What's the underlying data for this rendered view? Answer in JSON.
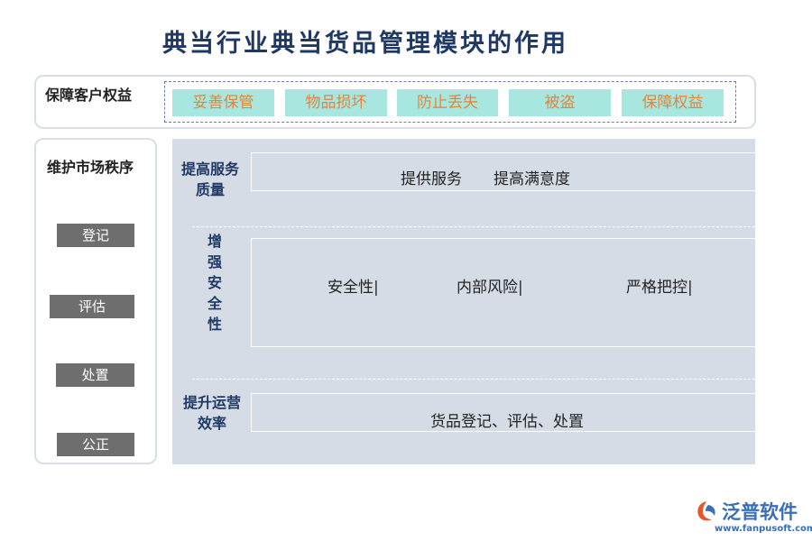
{
  "title": "典当行业典当货品管理模块的作用",
  "guarantee": {
    "label": "保障客户权益",
    "items": [
      "妥善保管",
      "物品损坏",
      "防止丢失",
      "被盗",
      "保障权益"
    ]
  },
  "market_order": {
    "label": "维护市场秩序",
    "steps": [
      "登记",
      "评估",
      "处置",
      "公正"
    ]
  },
  "sections": {
    "service": {
      "label_line1": "提高服务",
      "label_line2": "质量",
      "text1": "提供服务",
      "text2": "提高满意度"
    },
    "safety": {
      "label_chars": [
        "增",
        "强",
        "安",
        "全",
        "性"
      ],
      "items": [
        "安全性|",
        "内部风险|",
        "严格把控|"
      ]
    },
    "efficiency": {
      "label_line1": "提升运营",
      "label_line2": "效率",
      "text": "货品登记、评估、处置"
    }
  },
  "logo": {
    "name": "泛普软件",
    "url": "www.fanpusoft.com"
  },
  "colors": {
    "title": "#1f3864",
    "chip_bg": "#a8e6e0",
    "chip_text": "#e0863a",
    "panel_bg": "#d6dce6",
    "step_bg": "#6e6e6e",
    "logo": "#3a6fb7"
  }
}
